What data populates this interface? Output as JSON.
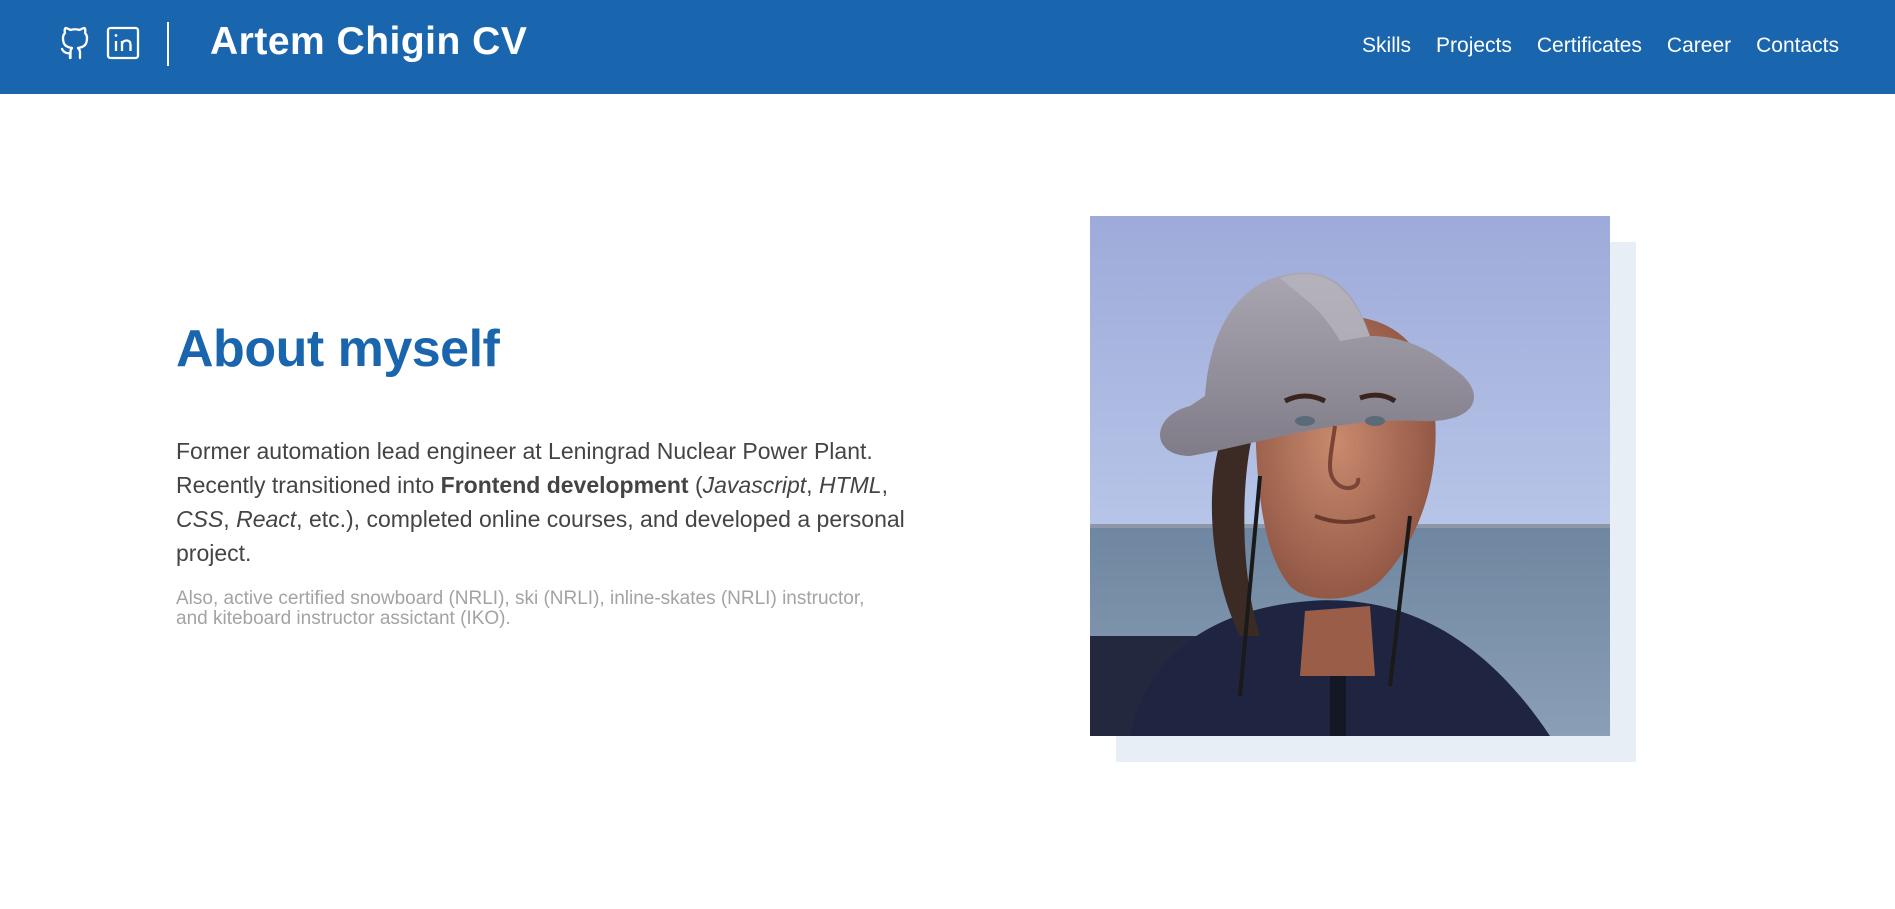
{
  "header": {
    "title": "Artem Chigin CV",
    "social": [
      {
        "name": "GitHub",
        "icon": "github-icon"
      },
      {
        "name": "LinkedIn",
        "icon": "linkedin-icon"
      }
    ],
    "nav": [
      "Skills",
      "Projects",
      "Certificates",
      "Career",
      "Contacts"
    ]
  },
  "about": {
    "title": "About myself",
    "line_1": "Former automation lead engineer at Leningrad Nuclear Power Plant.",
    "line_2_prefix": "Recently transitioned into ",
    "highlight": "Frontend development",
    "open_paren": " (",
    "tech_1": "Javascript",
    "sep_1": ", ",
    "tech_2": "HTML",
    "sep_2": ", ",
    "tech_3": "CSS",
    "sep_3": ", ",
    "tech_4": "React",
    "line_suffix": ", etc.), completed online courses, and developed a personal project.",
    "note": "Also, active certified snowboard (NRLI), ski (NRLI), inline-skates (NRLI) instructor, and kiteboard instructor assictant (IKO)."
  },
  "photo": {
    "subject": "portrait-photo"
  },
  "colors": {
    "brand": "#1a66ae",
    "text": "#444444",
    "muted": "#a3a3a3",
    "photo_backdrop": "#e8eef6"
  }
}
